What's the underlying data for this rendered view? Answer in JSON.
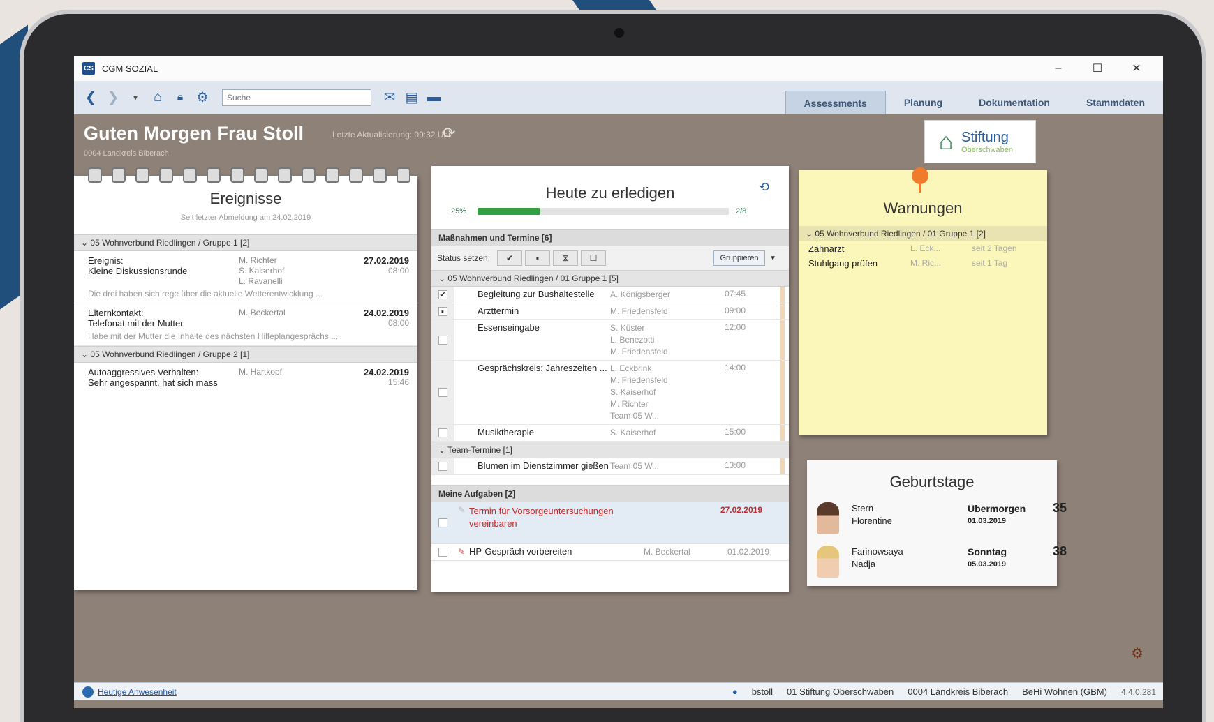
{
  "window": {
    "title": "CGM SOZIAL",
    "logo": "CS"
  },
  "toolbar": {
    "search_placeholder": "Suche",
    "icons": [
      "back-icon",
      "forward-icon",
      "home-icon",
      "lock-icon",
      "gear-icon",
      "mail-icon",
      "document-icon",
      "folder-icon"
    ]
  },
  "nav": {
    "tabs": [
      "Assessments",
      "Planung",
      "Dokumentation",
      "Stammdaten"
    ],
    "active": "Assessments"
  },
  "header": {
    "greeting": "Guten Morgen Frau Stoll",
    "last_update": "Letzte Aktualisierung: 09:32 Uhr",
    "org": "0004 Landkreis Biberach",
    "logo_line1": "Stiftung",
    "logo_line2": "Oberschwaben"
  },
  "ereignisse": {
    "title": "Ereignisse",
    "subtitle": "Seit letzter Abmeldung am 24.02.2019",
    "groups": [
      {
        "label": "05 Wohnverbund Riedlingen / Gruppe 1 [2]",
        "events": [
          {
            "title": "Ereignis:",
            "text": "Kleine Diskussionsrunde",
            "persons": [
              "M. Richter",
              "S. Kaiserhof",
              "L. Ravanelli"
            ],
            "date": "27.02.2019",
            "time": "08:00",
            "note": "Die drei haben sich rege über die aktuelle Wetterentwicklung ..."
          },
          {
            "title": "Elternkontakt:",
            "text": "Telefonat mit der Mutter",
            "persons": [
              "M. Beckertal"
            ],
            "date": "24.02.2019",
            "time": "08:00",
            "note": "Habe mit der Mutter die Inhalte des nächsten Hilfeplangesprächs ..."
          }
        ]
      },
      {
        "label": "05 Wohnverbund Riedlingen / Gruppe 2 [1]",
        "events": [
          {
            "title": "Autoaggressives Verhalten:",
            "text": "Sehr angespannt, hat sich mass",
            "persons": [
              "M. Hartkopf"
            ],
            "date": "24.02.2019",
            "time": "15:46",
            "note": ""
          }
        ]
      }
    ]
  },
  "heute": {
    "title": "Heute zu erledigen",
    "progress_label": "25%",
    "progress_fraction": 0.25,
    "progress_count": "2/8",
    "section_title": "Maßnahmen und Termine [6]",
    "status_label": "Status setzen:",
    "group_button": "Gruppieren",
    "group1": "05 Wohnverbund Riedlingen / 01 Gruppe 1 [5]",
    "tasks": [
      {
        "name": "Begleitung zur Bushaltestelle",
        "persons": [
          "A. Königsberger"
        ],
        "time": "07:45",
        "check": "✔"
      },
      {
        "name": "Arzttermin",
        "persons": [
          "M. Friedensfeld"
        ],
        "time": "09:00",
        "check": "▪"
      },
      {
        "name": "Essenseingabe",
        "persons": [
          "S. Küster",
          "L. Benezotti",
          "M. Friedensfeld"
        ],
        "time": "12:00",
        "check": ""
      },
      {
        "name": "Gesprächskreis: Jahreszeiten ...",
        "persons": [
          "L. Eckbrink",
          "M. Friedensfeld",
          "S. Kaiserhof",
          "M. Richter",
          "Team 05 W..."
        ],
        "time": "14:00",
        "check": ""
      },
      {
        "name": "Musiktherapie",
        "persons": [
          "S. Kaiserhof"
        ],
        "time": "15:00",
        "check": ""
      }
    ],
    "team_group": "Team-Termine [1]",
    "team_tasks": [
      {
        "name": "Blumen im Dienstzimmer gießen",
        "persons": [
          "Team 05 W..."
        ],
        "time": "13:00",
        "check": ""
      }
    ],
    "my_tasks_title": "Meine Aufgaben [2]",
    "my_tasks": [
      {
        "name": "Termin für Vorsorgeuntersuchungen vereinbaren",
        "person": "",
        "date": "27.02.2019",
        "overdue": true
      },
      {
        "name": "HP-Gespräch vorbereiten",
        "person": "M. Beckertal",
        "date": "01.02.2019",
        "overdue": false
      }
    ]
  },
  "warnungen": {
    "title": "Warnungen",
    "group": "05 Wohnverbund Riedlingen / 01 Gruppe 1 [2]",
    "rows": [
      {
        "name": "Zahnarzt",
        "person": "L. Eck...",
        "since": "seit 2 Tagen"
      },
      {
        "name": "Stuhlgang prüfen",
        "person": "M. Ric...",
        "since": "seit 1 Tag"
      }
    ]
  },
  "geburtstage": {
    "title": "Geburtstage",
    "rows": [
      {
        "last": "Stern",
        "first": "Florentine",
        "when": "Übermorgen",
        "date": "01.03.2019",
        "age": "35"
      },
      {
        "last": "Farinowsaya",
        "first": "Nadja",
        "when": "Sonntag",
        "date": "05.03.2019",
        "age": "38"
      }
    ]
  },
  "statusbar": {
    "presence": "Heutige Anwesenheit",
    "user": "bstoll",
    "org1": "01 Stiftung Oberschwaben",
    "org2": "0004 Landkreis Biberach",
    "org3": "BeHi Wohnen (GBM)",
    "version": "4.4.0.281"
  },
  "colors": {
    "accent": "#2a5d9a",
    "progress": "#32a041",
    "overdue": "#c42b2b",
    "sticky": "#fbf6ba"
  }
}
